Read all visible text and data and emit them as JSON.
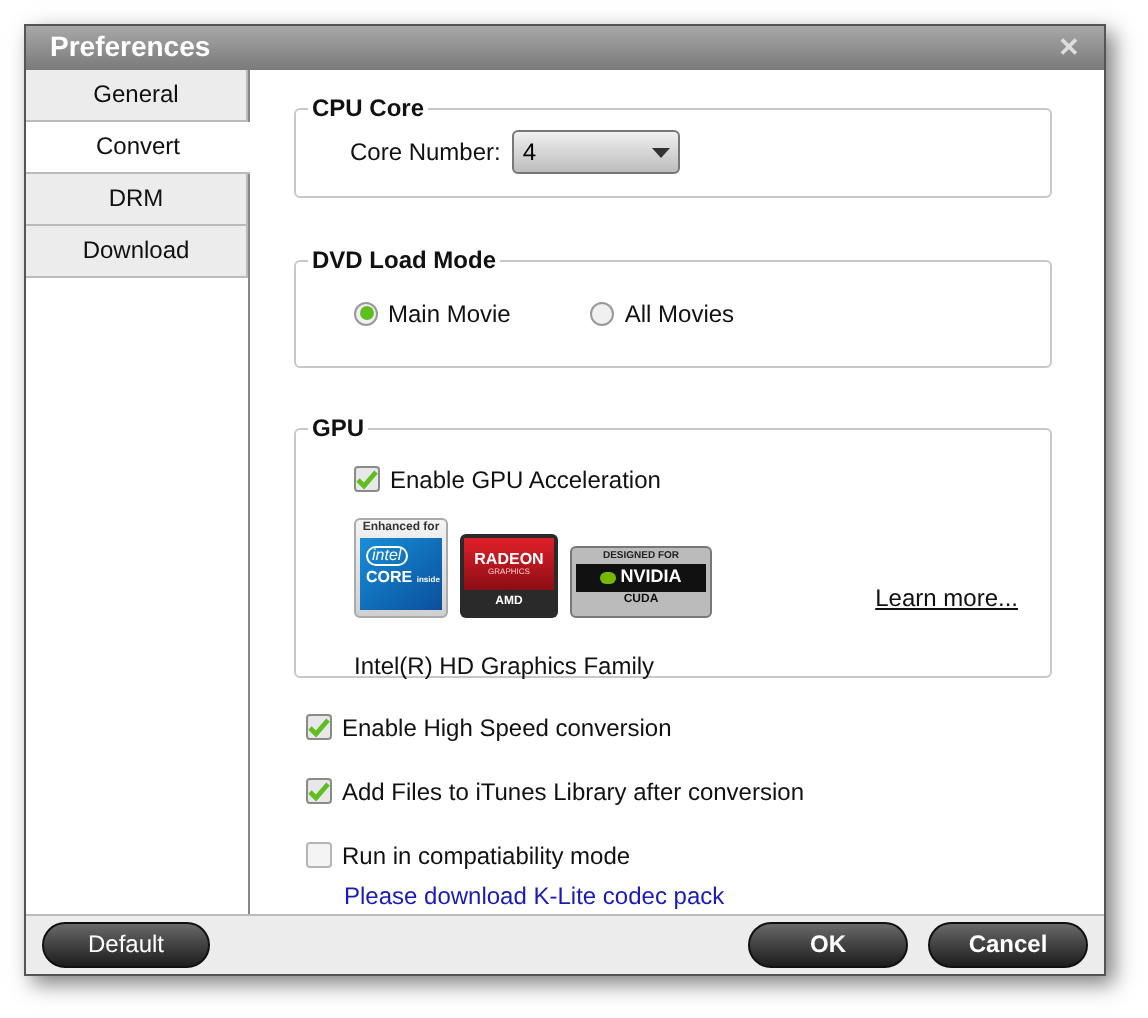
{
  "window": {
    "title": "Preferences",
    "close": "✕"
  },
  "tabs": [
    {
      "label": "General",
      "selected": false
    },
    {
      "label": "Convert",
      "selected": true
    },
    {
      "label": "DRM",
      "selected": false
    },
    {
      "label": "Download",
      "selected": false
    }
  ],
  "cpu": {
    "title": "CPU Core",
    "label": "Core Number:",
    "value": "4"
  },
  "dvd": {
    "title": "DVD Load Mode",
    "options": [
      {
        "label": "Main Movie",
        "selected": true
      },
      {
        "label": "All Movies",
        "selected": false
      }
    ]
  },
  "gpu": {
    "title": "GPU",
    "enable": {
      "label": "Enable GPU Acceleration",
      "checked": true
    },
    "logos": [
      {
        "kind": "intel",
        "lines": [
          "Enhanced for",
          "intel",
          "CORE",
          "inside"
        ]
      },
      {
        "kind": "amd",
        "lines": [
          "RADEON",
          "GRAPHICS",
          "AMD"
        ]
      },
      {
        "kind": "nvidia",
        "lines": [
          "DESIGNED FOR",
          "NVIDIA",
          "CUDA"
        ]
      }
    ],
    "learn_more": "Learn more...",
    "device": "Intel(R) HD Graphics Family"
  },
  "options": [
    {
      "label": "Enable High Speed conversion",
      "checked": true
    },
    {
      "label": "Add Files to iTunes Library after conversion",
      "checked": true
    },
    {
      "label": "Run in compatiability mode",
      "checked": false
    }
  ],
  "codec_link": "Please download K-Lite codec pack",
  "buttons": {
    "default": "Default",
    "ok": "OK",
    "cancel": "Cancel"
  }
}
